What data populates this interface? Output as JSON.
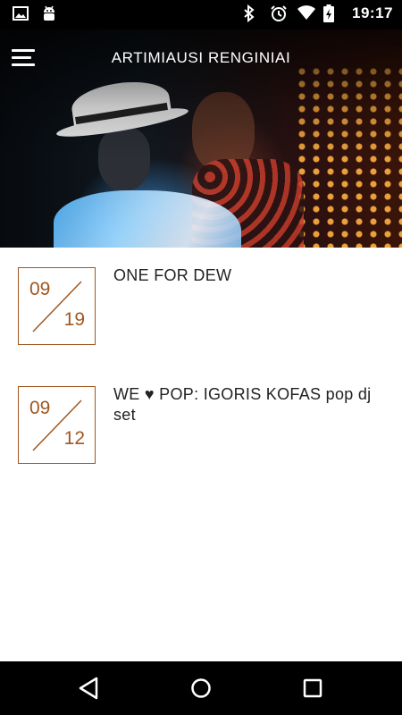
{
  "status_bar": {
    "time": "19:17",
    "left_icons": [
      "image-icon",
      "android-icon"
    ],
    "right_icons": [
      "bluetooth-icon",
      "alarm-icon",
      "wifi-icon",
      "battery-charging-icon"
    ]
  },
  "header": {
    "title": "ARTIMIAUSI RENGINIAI",
    "menu_icon": "hamburger-menu-icon"
  },
  "events": [
    {
      "month": "09",
      "day": "19",
      "title": "ONE FOR DEW"
    },
    {
      "month": "09",
      "day": "12",
      "title": "WE ♥ POP: IGORIS KOFAS pop dj set"
    }
  ],
  "nav_bar": {
    "buttons": [
      "back-icon",
      "home-icon",
      "recent-apps-icon"
    ]
  },
  "colors": {
    "accent": "#a0561f",
    "text": "#222222",
    "status_bar_bg": "#000000",
    "nav_bar_bg": "#000000"
  }
}
